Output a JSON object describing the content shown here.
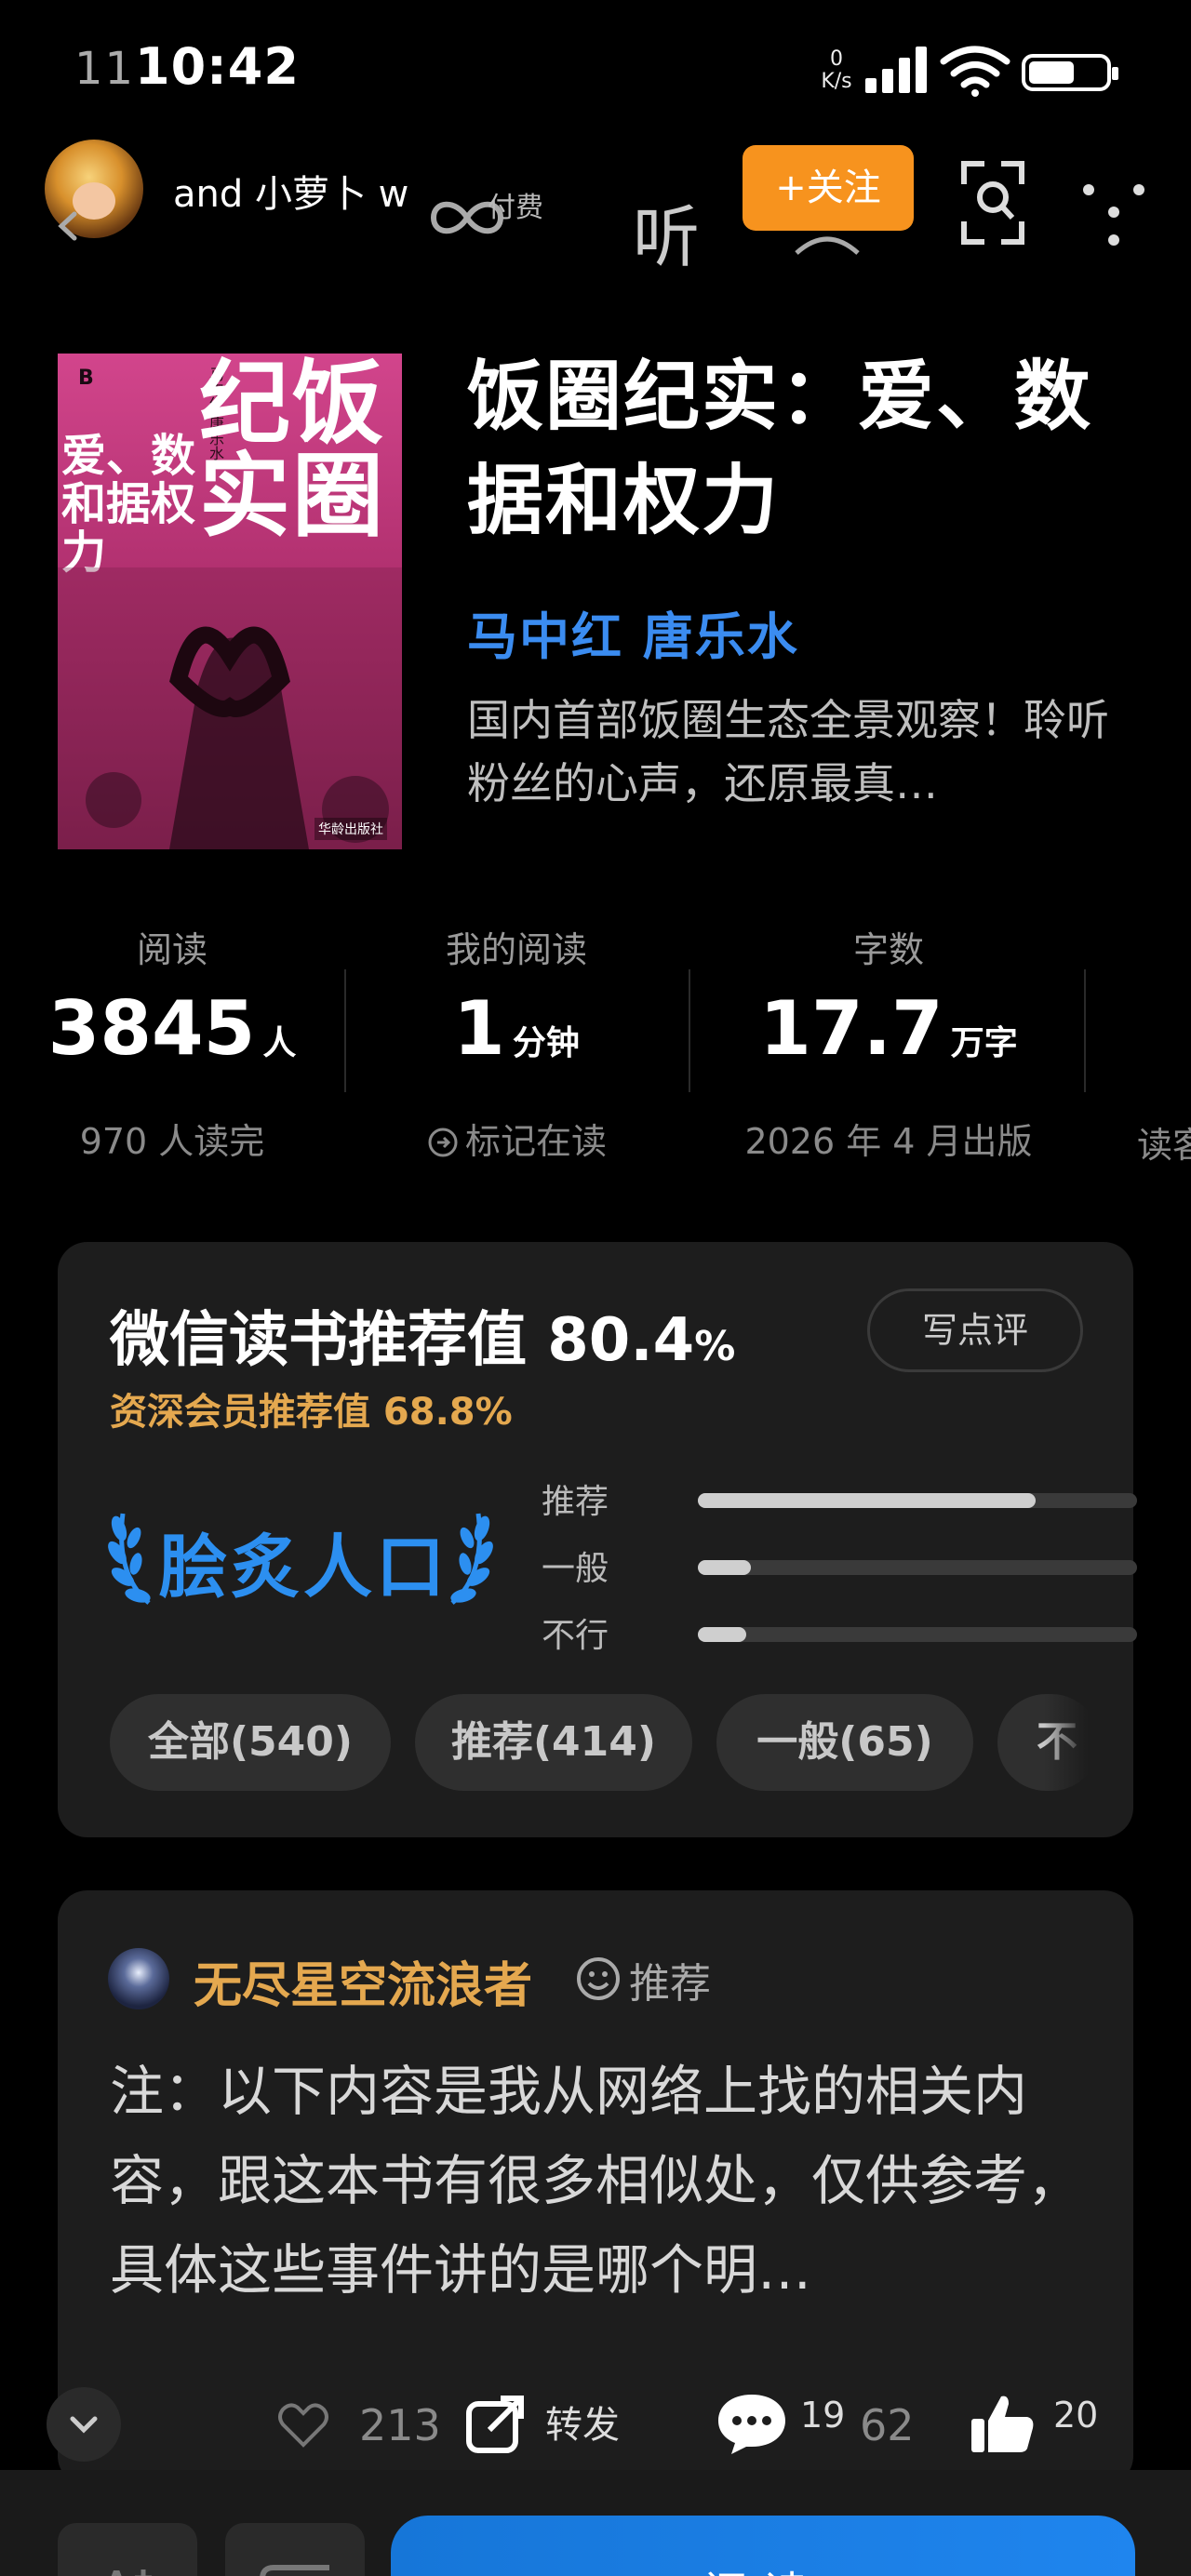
{
  "status_bar": {
    "time_behind": "11",
    "time": "10:42",
    "net_speed_value": "0",
    "net_speed_unit": "K/s",
    "battery_level": "36"
  },
  "nav": {
    "username": "and 小萝卜 w",
    "paid_label": "付费",
    "listen_label": "听",
    "follow_label": "+关注"
  },
  "book": {
    "title": "饭圈纪实：爱、数据和权力",
    "authors": "马中红 唐乐水",
    "description": "国内首部饭圈生态全景观察！聆听粉丝的心声，还原最真…",
    "cover": {
      "logo": "B",
      "title_main": "纪饭实圈",
      "title_sub": "爱、数和据权力",
      "authors_mini": "马中红 唐乐水",
      "publisher": "华龄出版社"
    }
  },
  "stats": [
    {
      "label": "阅读",
      "value": "3845",
      "unit": "人",
      "sub": "970 人读完"
    },
    {
      "label": "我的阅读",
      "value": "1",
      "unit": "分钟",
      "sub": "标记在读"
    },
    {
      "label": "字数",
      "value": "17.7",
      "unit": "万字",
      "sub": "2026 年 4 月出版"
    },
    {
      "sub": "读客"
    }
  ],
  "rating": {
    "title": "微信读书推荐值 80.4",
    "percent_sign": "%",
    "member_sub": "资深会员推荐值 68.8%",
    "write_label": "写点评",
    "badge": "脍炙人口",
    "bars": [
      {
        "label": "推荐",
        "share": 0.77
      },
      {
        "label": "一般",
        "share": 0.12
      },
      {
        "label": "不行",
        "share": 0.11
      }
    ],
    "filters": [
      "全部(540)",
      "推荐(414)",
      "一般(65)",
      "不"
    ]
  },
  "review": {
    "reviewer": "无尽星空流浪者",
    "tag": "推荐",
    "text": "注：以下内容是我从网络上找的相关内容，跟这本书有很多相似处，仅供参考，具体这些事件讲的是哪个明…",
    "likes": "213",
    "share_label": "转发",
    "comments": "19",
    "comments_alt": "62",
    "thumbs": "20"
  },
  "bottom": {
    "read_label": "阅读"
  },
  "colors": {
    "accent_orange": "#f7931e",
    "author_blue": "#3b8cf0",
    "gold": "#e4a84f",
    "badge_blue": "#2c8ff0",
    "read_blue": "#1f85ee"
  }
}
